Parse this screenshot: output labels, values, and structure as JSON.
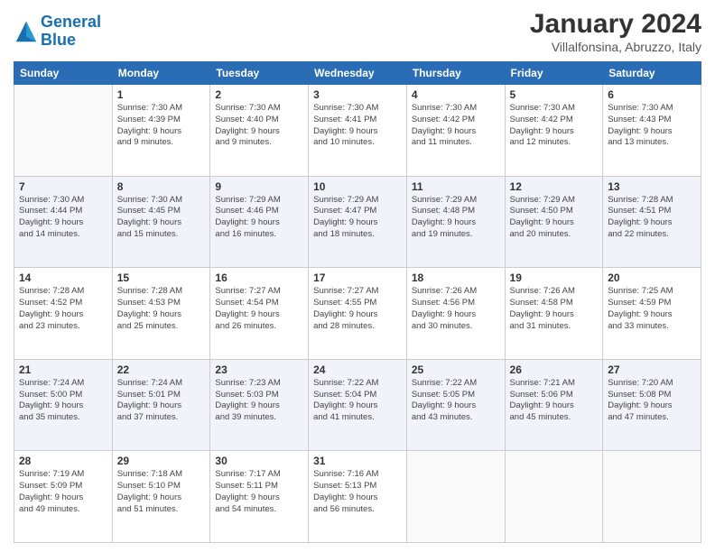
{
  "header": {
    "logo_line1": "General",
    "logo_line2": "Blue",
    "title": "January 2024",
    "subtitle": "Villalfonsina, Abruzzo, Italy"
  },
  "days_of_week": [
    "Sunday",
    "Monday",
    "Tuesday",
    "Wednesday",
    "Thursday",
    "Friday",
    "Saturday"
  ],
  "weeks": [
    [
      {
        "day": "",
        "info": ""
      },
      {
        "day": "1",
        "info": "Sunrise: 7:30 AM\nSunset: 4:39 PM\nDaylight: 9 hours\nand 9 minutes."
      },
      {
        "day": "2",
        "info": "Sunrise: 7:30 AM\nSunset: 4:40 PM\nDaylight: 9 hours\nand 9 minutes."
      },
      {
        "day": "3",
        "info": "Sunrise: 7:30 AM\nSunset: 4:41 PM\nDaylight: 9 hours\nand 10 minutes."
      },
      {
        "day": "4",
        "info": "Sunrise: 7:30 AM\nSunset: 4:42 PM\nDaylight: 9 hours\nand 11 minutes."
      },
      {
        "day": "5",
        "info": "Sunrise: 7:30 AM\nSunset: 4:42 PM\nDaylight: 9 hours\nand 12 minutes."
      },
      {
        "day": "6",
        "info": "Sunrise: 7:30 AM\nSunset: 4:43 PM\nDaylight: 9 hours\nand 13 minutes."
      }
    ],
    [
      {
        "day": "7",
        "info": "Sunrise: 7:30 AM\nSunset: 4:44 PM\nDaylight: 9 hours\nand 14 minutes."
      },
      {
        "day": "8",
        "info": "Sunrise: 7:30 AM\nSunset: 4:45 PM\nDaylight: 9 hours\nand 15 minutes."
      },
      {
        "day": "9",
        "info": "Sunrise: 7:29 AM\nSunset: 4:46 PM\nDaylight: 9 hours\nand 16 minutes."
      },
      {
        "day": "10",
        "info": "Sunrise: 7:29 AM\nSunset: 4:47 PM\nDaylight: 9 hours\nand 18 minutes."
      },
      {
        "day": "11",
        "info": "Sunrise: 7:29 AM\nSunset: 4:48 PM\nDaylight: 9 hours\nand 19 minutes."
      },
      {
        "day": "12",
        "info": "Sunrise: 7:29 AM\nSunset: 4:50 PM\nDaylight: 9 hours\nand 20 minutes."
      },
      {
        "day": "13",
        "info": "Sunrise: 7:28 AM\nSunset: 4:51 PM\nDaylight: 9 hours\nand 22 minutes."
      }
    ],
    [
      {
        "day": "14",
        "info": "Sunrise: 7:28 AM\nSunset: 4:52 PM\nDaylight: 9 hours\nand 23 minutes."
      },
      {
        "day": "15",
        "info": "Sunrise: 7:28 AM\nSunset: 4:53 PM\nDaylight: 9 hours\nand 25 minutes."
      },
      {
        "day": "16",
        "info": "Sunrise: 7:27 AM\nSunset: 4:54 PM\nDaylight: 9 hours\nand 26 minutes."
      },
      {
        "day": "17",
        "info": "Sunrise: 7:27 AM\nSunset: 4:55 PM\nDaylight: 9 hours\nand 28 minutes."
      },
      {
        "day": "18",
        "info": "Sunrise: 7:26 AM\nSunset: 4:56 PM\nDaylight: 9 hours\nand 30 minutes."
      },
      {
        "day": "19",
        "info": "Sunrise: 7:26 AM\nSunset: 4:58 PM\nDaylight: 9 hours\nand 31 minutes."
      },
      {
        "day": "20",
        "info": "Sunrise: 7:25 AM\nSunset: 4:59 PM\nDaylight: 9 hours\nand 33 minutes."
      }
    ],
    [
      {
        "day": "21",
        "info": "Sunrise: 7:24 AM\nSunset: 5:00 PM\nDaylight: 9 hours\nand 35 minutes."
      },
      {
        "day": "22",
        "info": "Sunrise: 7:24 AM\nSunset: 5:01 PM\nDaylight: 9 hours\nand 37 minutes."
      },
      {
        "day": "23",
        "info": "Sunrise: 7:23 AM\nSunset: 5:03 PM\nDaylight: 9 hours\nand 39 minutes."
      },
      {
        "day": "24",
        "info": "Sunrise: 7:22 AM\nSunset: 5:04 PM\nDaylight: 9 hours\nand 41 minutes."
      },
      {
        "day": "25",
        "info": "Sunrise: 7:22 AM\nSunset: 5:05 PM\nDaylight: 9 hours\nand 43 minutes."
      },
      {
        "day": "26",
        "info": "Sunrise: 7:21 AM\nSunset: 5:06 PM\nDaylight: 9 hours\nand 45 minutes."
      },
      {
        "day": "27",
        "info": "Sunrise: 7:20 AM\nSunset: 5:08 PM\nDaylight: 9 hours\nand 47 minutes."
      }
    ],
    [
      {
        "day": "28",
        "info": "Sunrise: 7:19 AM\nSunset: 5:09 PM\nDaylight: 9 hours\nand 49 minutes."
      },
      {
        "day": "29",
        "info": "Sunrise: 7:18 AM\nSunset: 5:10 PM\nDaylight: 9 hours\nand 51 minutes."
      },
      {
        "day": "30",
        "info": "Sunrise: 7:17 AM\nSunset: 5:11 PM\nDaylight: 9 hours\nand 54 minutes."
      },
      {
        "day": "31",
        "info": "Sunrise: 7:16 AM\nSunset: 5:13 PM\nDaylight: 9 hours\nand 56 minutes."
      },
      {
        "day": "",
        "info": ""
      },
      {
        "day": "",
        "info": ""
      },
      {
        "day": "",
        "info": ""
      }
    ]
  ]
}
